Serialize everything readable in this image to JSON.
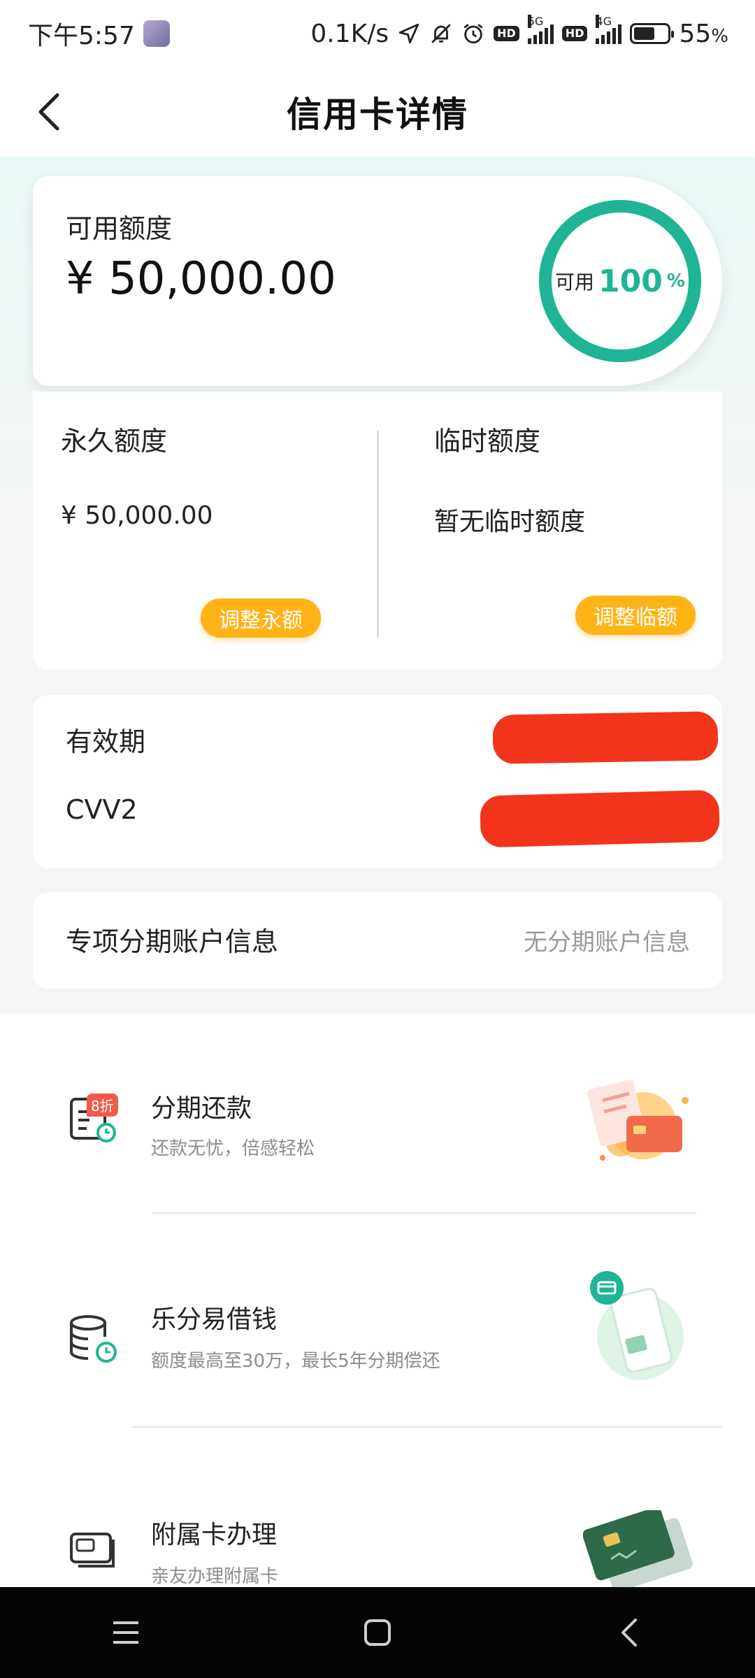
{
  "status_bar": {
    "time": "下午5:57",
    "network_speed": "0.1K/s",
    "battery": "55",
    "battery_unit": "%",
    "sim1_tag": "5G",
    "sim2_tag": "4G",
    "hd1": "HD",
    "hd2": "HD"
  },
  "nav": {
    "title": "信用卡详情"
  },
  "available": {
    "label": "可用额度",
    "amount": "¥ 50,000.00",
    "ring_label": "可用",
    "ring_percent": "100",
    "ring_unit": "%",
    "ring_color": "#1fb494"
  },
  "limits": {
    "permanent_label": "永久额度",
    "permanent_value": "¥ 50,000.00",
    "permanent_button": "调整永额",
    "temporary_label": "临时额度",
    "temporary_value": "暂无临时额度",
    "temporary_button": "调整临额",
    "button_color": "#ffb317"
  },
  "card_info": {
    "validity_label": "有效期",
    "cvv_label": "CVV2"
  },
  "installment_account": {
    "label": "专项分期账户信息",
    "value": "无分期账户信息"
  },
  "services": [
    {
      "title": "分期还款",
      "subtitle": "还款无忧，倍感轻松",
      "badge": "8折",
      "icon": "bill-clock-icon"
    },
    {
      "title": "乐分易借钱",
      "subtitle": "额度最高至30万，最长5年分期偿还",
      "icon": "coins-clock-icon"
    },
    {
      "title": "附属卡办理",
      "subtitle": "亲友办理附属卡",
      "icon": "card-icon"
    }
  ],
  "system_nav": {
    "buttons": [
      "menu-icon",
      "home-icon",
      "back-icon"
    ]
  }
}
